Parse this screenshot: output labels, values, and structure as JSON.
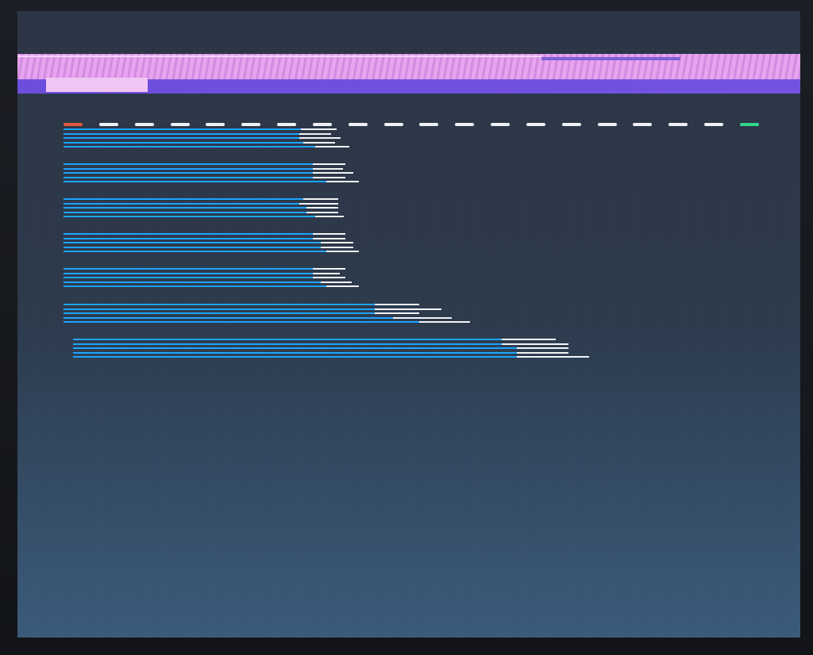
{
  "screen": {
    "background_top": "#2b3444",
    "background_bottom": "#3a5a7a",
    "band_colors": {
      "pink": "#e6a4ee",
      "purple": "#6c4ddc",
      "tab": "#f0c5f6"
    }
  },
  "progress_row": {
    "segments": 20,
    "start_color": "#e0583c",
    "end_color": "#32d48a",
    "dash_color": "#eef1f5"
  },
  "bar_groups": [
    {
      "lines": [
        [
          0.825,
          0.95
        ],
        [
          0.82,
          0.93
        ],
        [
          0.82,
          0.965
        ],
        [
          0.835,
          0.945
        ],
        [
          0.875,
          0.995
        ]
      ]
    },
    {
      "lines": [
        [
          0.845,
          0.955
        ],
        [
          0.845,
          0.945
        ],
        [
          0.845,
          0.98
        ],
        [
          0.845,
          0.955
        ],
        [
          0.89,
          1.0
        ]
      ]
    },
    {
      "lines": [
        [
          0.835,
          0.955
        ],
        [
          0.82,
          0.955
        ],
        [
          0.845,
          0.955
        ],
        [
          0.845,
          0.955
        ],
        [
          0.875,
          0.975
        ]
      ]
    },
    {
      "lines": [
        [
          0.845,
          0.955
        ],
        [
          0.845,
          0.955
        ],
        [
          0.87,
          0.98
        ],
        [
          0.87,
          0.98
        ],
        [
          0.89,
          1.0
        ]
      ]
    },
    {
      "lines": [
        [
          0.845,
          0.955
        ],
        [
          0.845,
          0.935
        ],
        [
          0.845,
          0.955
        ],
        [
          0.87,
          0.975
        ],
        [
          0.89,
          1.0
        ]
      ]
    },
    {
      "lines": [
        [
          0.765,
          0.875
        ],
        [
          0.765,
          0.93
        ],
        [
          0.765,
          0.875
        ],
        [
          0.81,
          0.955
        ],
        [
          0.875,
          1.0
        ]
      ]
    },
    {
      "lines": [
        [
          0.83,
          0.935
        ],
        [
          0.83,
          0.96
        ],
        [
          0.86,
          0.96
        ],
        [
          0.86,
          0.96
        ],
        [
          0.86,
          1.0
        ]
      ]
    }
  ]
}
